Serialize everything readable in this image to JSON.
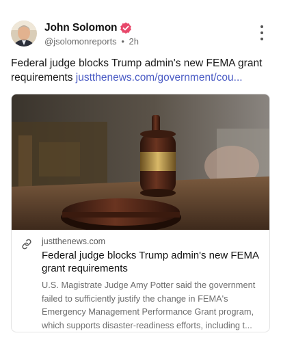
{
  "post": {
    "author_name": "John Solomon",
    "handle": "@jsolomonreports",
    "time": "2h",
    "separator": "•",
    "text": "Federal judge blocks Trump admin's new FEMA grant requirements",
    "link_text": "justthenews.com/government/cou..."
  },
  "card": {
    "domain": "justthenews.com",
    "title": "Federal judge blocks Trump admin's new FEMA grant requirements",
    "description_lines": [
      "U.S. Magistrate Judge Amy Potter said the government",
      "failed to sufficiently justify the change in FEMA's",
      "Emergency Management Performance Grant program,",
      "which supports disaster-readiness efforts, including t..."
    ]
  },
  "icons": {
    "verified": "verified-badge-icon",
    "more": "more-vertical-icon",
    "link": "link-icon"
  },
  "colors": {
    "verified_badge": "#e8486b",
    "link": "#4a5bc4"
  }
}
